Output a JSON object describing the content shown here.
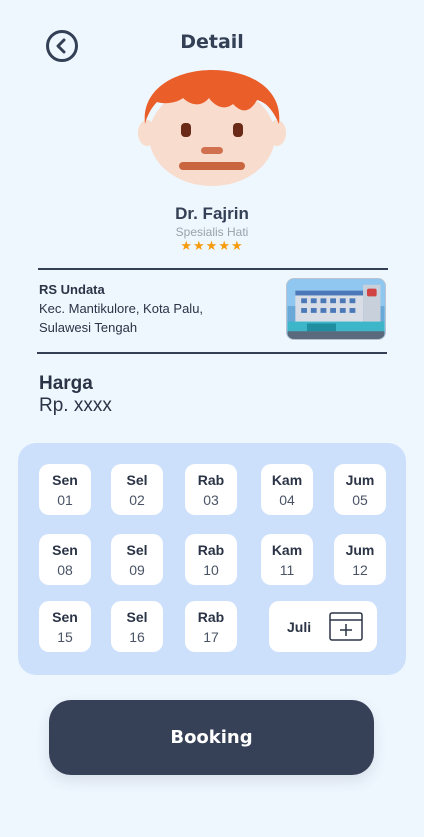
{
  "header": {
    "title": "Detail",
    "back_icon": "chevron-left-circle-icon"
  },
  "doctor": {
    "name": "Dr. Fajrin",
    "specialty": "Spesialis Hati",
    "rating": 5,
    "stars_text": "★★★★★"
  },
  "hospital": {
    "name": "RS Undata",
    "address_line1": "Kec. Mantikulore, Kota Palu,",
    "address_line2": "Sulawesi Tengah"
  },
  "price": {
    "label": "Harga",
    "value": "Rp. xxxx"
  },
  "calendar": {
    "days": [
      {
        "name": "Sen",
        "num": "01"
      },
      {
        "name": "Sel",
        "num": "02"
      },
      {
        "name": "Rab",
        "num": "03"
      },
      {
        "name": "Kam",
        "num": "04"
      },
      {
        "name": "Jum",
        "num": "05"
      },
      {
        "name": "Sen",
        "num": "08"
      },
      {
        "name": "Sel",
        "num": "09"
      },
      {
        "name": "Rab",
        "num": "10"
      },
      {
        "name": "Kam",
        "num": "11"
      },
      {
        "name": "Jum",
        "num": "12"
      },
      {
        "name": "Sen",
        "num": "15"
      },
      {
        "name": "Sel",
        "num": "16"
      },
      {
        "name": "Rab",
        "num": "17"
      }
    ],
    "month": "Juli",
    "month_icon": "calendar-add-icon"
  },
  "booking": {
    "label": "Booking"
  },
  "colors": {
    "background": "#eef6fe",
    "primary": "#364057",
    "calendar_bg": "#cde0fb",
    "hair": "#ea5e2a",
    "star": "#f59b0c"
  }
}
